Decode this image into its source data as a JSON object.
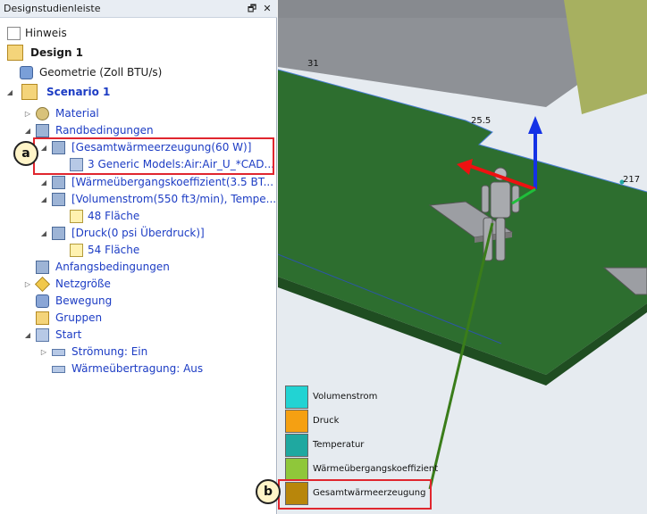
{
  "panel": {
    "title": "Designstudienleiste",
    "pin_glyph": "🗗",
    "close_glyph": "✕"
  },
  "tree": {
    "hint": "Hinweis",
    "design": "Design 1",
    "geometry": "Geometrie (Zoll BTU/s)",
    "scenario": "Scenario 1",
    "material": "Material",
    "boundary": "Randbedingungen",
    "heat_gen": "[Gesamtwärmeerzeugung(60 W)]",
    "heat_gen_child": "3 Generic Models:Air:Air_U_*CAD...",
    "htc": "[Wärmeübergangskoeffizient(3.5 BT...",
    "flow": "[Volumenstrom(550 ft3/min), Tempe...",
    "flow_child": "48 Fläche",
    "pressure": "[Druck(0 psi Überdruck)]",
    "pressure_child": "54 Fläche",
    "initial": "Anfangsbedingungen",
    "mesh": "Netzgröße",
    "motion": "Bewegung",
    "groups": "Gruppen",
    "start": "Start",
    "flow_on": "Strömung: Ein",
    "heat_off": "Wärmeübertragung: Aus"
  },
  "callouts": {
    "a": "a",
    "b": "b"
  },
  "viewport": {
    "labels": [
      "31",
      "25.5",
      "217"
    ]
  },
  "legend": [
    {
      "label": "Volumenstrom",
      "color": "#22d3d3"
    },
    {
      "label": "Druck",
      "color": "#f5a012"
    },
    {
      "label": "Temperatur",
      "color": "#1fa8a0"
    },
    {
      "label": "Wärmeübergangskoeffizient",
      "color": "#8fc73a"
    },
    {
      "label": "Gesamtwärmeerzeugung",
      "color": "#b8860b"
    }
  ]
}
